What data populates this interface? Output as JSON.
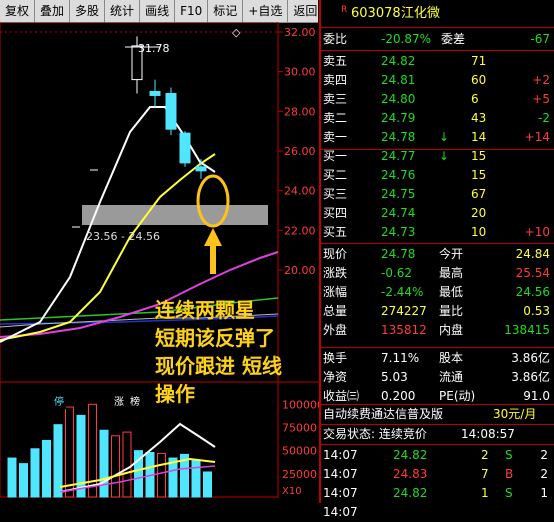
{
  "toolbar": [
    "复权",
    "叠加",
    "多股",
    "统计",
    "画线",
    "F10",
    "标记",
    "+自选",
    "返回"
  ],
  "chart": {
    "y_ticks": [
      "32.00",
      "30.00",
      "28.00",
      "26.00",
      "24.00",
      "22.00",
      "20.00"
    ],
    "high_label": "31.78",
    "range_label": "23.56 - 24.56",
    "tags": [
      "停",
      "涨",
      "榜"
    ],
    "annotation": [
      "连续两颗星",
      "短期该反弹了",
      "现价跟进 短线",
      "操作"
    ],
    "vol_ticks": [
      "100000",
      "75000",
      "50000",
      "25000"
    ],
    "vol_unit": "X10",
    "diamond": "◇"
  },
  "stock": {
    "badge": "R",
    "code": "603078",
    "name": "江化微"
  },
  "weibi": {
    "label1": "委比",
    "val1": "-20.87%",
    "label2": "委差",
    "val2": "-67"
  },
  "sells": [
    {
      "label": "卖五",
      "price": "24.82",
      "vol": "71",
      "chg": ""
    },
    {
      "label": "卖四",
      "price": "24.81",
      "vol": "60",
      "chg": "+2"
    },
    {
      "label": "卖三",
      "price": "24.80",
      "vol": "6",
      "chg": "+5"
    },
    {
      "label": "卖二",
      "price": "24.79",
      "vol": "43",
      "chg": "-2"
    },
    {
      "label": "卖一",
      "price": "24.78",
      "vol": "14",
      "chg": "+14",
      "arrow": "↓"
    }
  ],
  "buys": [
    {
      "label": "买一",
      "price": "24.77",
      "vol": "15",
      "chg": "",
      "arrow": "↓"
    },
    {
      "label": "买二",
      "price": "24.76",
      "vol": "15",
      "chg": ""
    },
    {
      "label": "买三",
      "price": "24.75",
      "vol": "67",
      "chg": ""
    },
    {
      "label": "买四",
      "price": "24.74",
      "vol": "20",
      "chg": ""
    },
    {
      "label": "买五",
      "price": "24.73",
      "vol": "10",
      "chg": "+10"
    }
  ],
  "quote": [
    {
      "l1": "现价",
      "v1": "24.78",
      "l2": "今开",
      "v2": "24.84"
    },
    {
      "l1": "涨跌",
      "v1": "-0.62",
      "l2": "最高",
      "v2": "25.54"
    },
    {
      "l1": "涨幅",
      "v1": "-2.44%",
      "l2": "最低",
      "v2": "24.56"
    },
    {
      "l1": "总量",
      "v1": "274227",
      "l2": "量比",
      "v2": "0.53"
    },
    {
      "l1": "外盘",
      "v1": "135812",
      "l2": "内盘",
      "v2": "138415"
    }
  ],
  "stats": [
    {
      "l1": "换手",
      "v1": "7.11%",
      "l2": "股本",
      "v2": "3.86亿"
    },
    {
      "l1": "净资",
      "v1": "5.03",
      "l2": "流通",
      "v2": "3.86亿"
    },
    {
      "l1": "收益㈢",
      "v1": "0.200",
      "l2": "PE(动)",
      "v2": "91.0"
    }
  ],
  "promo": {
    "text": "自动续费通达信普及版",
    "price": "30元/月"
  },
  "trade_status": {
    "label": "交易状态: 连续竞价",
    "time": "14:08:57"
  },
  "ticks": [
    {
      "time": "14:07",
      "price": "24.82",
      "vol": "2",
      "dir": "S",
      "n": "2"
    },
    {
      "time": "14:07",
      "price": "24.83",
      "vol": "7",
      "dir": "B",
      "n": "2"
    },
    {
      "time": "14:07",
      "price": "24.82",
      "vol": "1",
      "dir": "S",
      "n": "1"
    },
    {
      "time": "14:07",
      "price": "",
      "vol": "",
      "dir": "",
      "n": ""
    }
  ],
  "colors": {
    "up": "#ff3b3b",
    "down": "#1edc1e",
    "accent": "#ffd21a",
    "border": "#bb0000",
    "ma5": "#ffffff",
    "ma10": "#ffff3a",
    "ma20": "#e040e0",
    "ma60": "#30c030"
  },
  "candles": [
    {
      "o": 29.6,
      "c": 31.3,
      "h": 31.78,
      "l": 28.9
    },
    {
      "o": 29.0,
      "c": 28.8,
      "h": 29.6,
      "l": 28.2
    },
    {
      "o": 28.9,
      "c": 27.1,
      "h": 29.2,
      "l": 26.8
    },
    {
      "o": 26.9,
      "c": 25.4,
      "h": 27.0,
      "l": 25.2
    },
    {
      "o": 25.2,
      "c": 25.0,
      "h": 25.6,
      "l": 24.6
    }
  ],
  "volumes": [
    42000,
    36000,
    52000,
    61000,
    78000,
    97000,
    88000,
    100000,
    72000,
    66000,
    70000,
    50000,
    48000,
    47000,
    42000,
    46000,
    40000,
    27000
  ]
}
